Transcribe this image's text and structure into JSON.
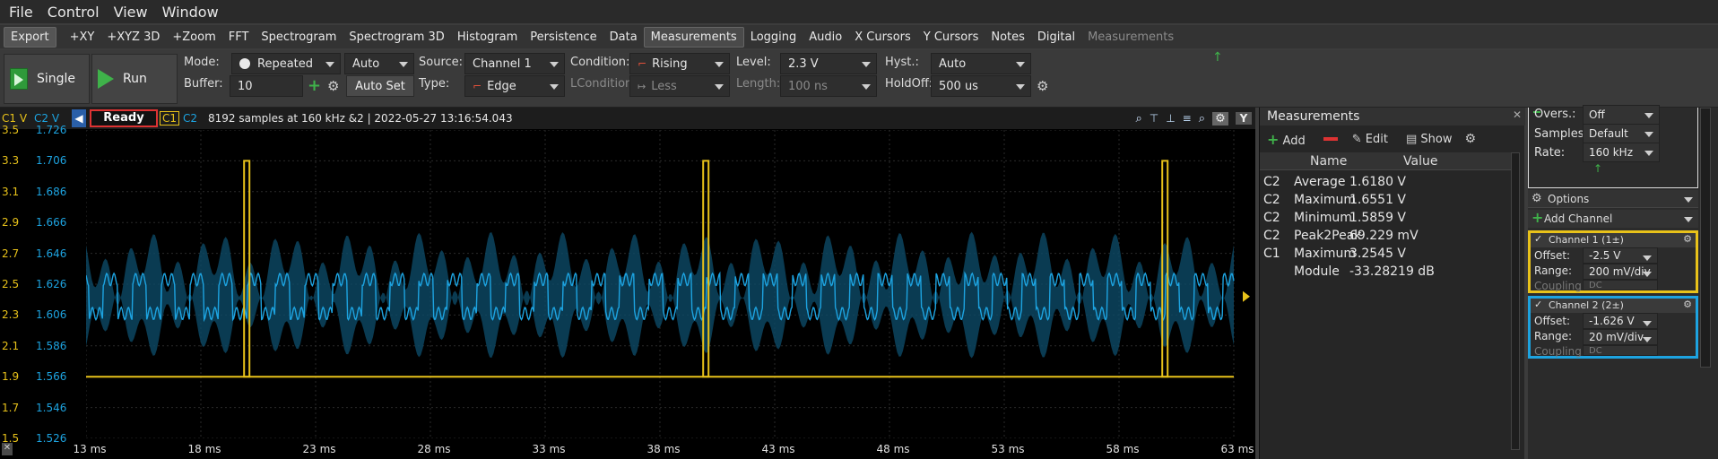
{
  "menu": [
    "File",
    "Control",
    "View",
    "Window"
  ],
  "tabs": {
    "export": "Export",
    "items": [
      "+XY",
      "+XYZ 3D",
      "+Zoom",
      "FFT",
      "Spectrogram",
      "Spectrogram 3D",
      "Histogram",
      "Persistence",
      "Data",
      "Measurements",
      "Logging",
      "Audio",
      "X Cursors",
      "Y Cursors",
      "Notes",
      "Digital"
    ],
    "active": "Measurements",
    "disabled": "Measurements"
  },
  "control": {
    "single": "Single",
    "run": "Run",
    "mode_label": "Mode:",
    "mode_value": "Repeated",
    "mode_auto": "Auto",
    "buffer_label": "Buffer:",
    "buffer_value": "10",
    "autoset": "Auto Set",
    "source_label": "Source:",
    "source_value": "Channel 1",
    "type_label": "Type:",
    "type_value": "Edge",
    "condition_label": "Condition:",
    "condition_value": "Rising",
    "lcondition_label": "LCondition:",
    "lcondition_value": "Less",
    "level_label": "Level:",
    "level_value": "2.3 V",
    "length_label": "Length:",
    "length_value": "100 ns",
    "hyst_label": "Hyst.:",
    "hyst_value": "Auto",
    "holdoff_label": "HoldOff:",
    "holdoff_value": "500 us"
  },
  "plot": {
    "c1_axis": "C1 V",
    "c2_axis": "C2 V",
    "status": "Ready",
    "c1_tag": "C1",
    "c2_tag": "C2",
    "info": "8192 samples at 160 kHz &2 | 2022-05-27 13:16:54.043",
    "y_axis_btn": "Y",
    "c1_ticks": [
      "3.5",
      "3.3",
      "3.1",
      "2.9",
      "2.7",
      "2.5",
      "2.3",
      "2.1",
      "1.9",
      "1.7",
      "1.5"
    ],
    "c2_ticks": [
      "1.726",
      "1.706",
      "1.686",
      "1.666",
      "1.646",
      "1.626",
      "1.606",
      "1.586",
      "1.566",
      "1.546",
      "1.526"
    ],
    "x_ticks": [
      "13 ms",
      "18 ms",
      "23 ms",
      "28 ms",
      "33 ms",
      "38 ms",
      "43 ms",
      "48 ms",
      "53 ms",
      "58 ms",
      "63 ms"
    ]
  },
  "chart_data": {
    "type": "line",
    "x_unit": "ms",
    "xlim": [
      13,
      63
    ],
    "series": [
      {
        "name": "C1",
        "color": "#e8c21a",
        "baseline_v": 1.9,
        "pulses_ms": [
          20.0,
          40.0,
          60.0
        ],
        "pulse_high_v": 3.3
      },
      {
        "name": "C2",
        "color": "#1da3e0",
        "mean_v": 1.618,
        "min_v": 1.5859,
        "max_v": 1.6551
      }
    ],
    "c1_ylim": [
      1.5,
      3.5
    ],
    "c2_ylim": [
      1.526,
      1.726
    ]
  },
  "measurements": {
    "title": "Measurements",
    "add": "Add",
    "edit": "Edit",
    "show": "Show",
    "headers": [
      "Name",
      "Value"
    ],
    "rows": [
      {
        "ch": "C2",
        "name": "Average",
        "value": "1.6180 V"
      },
      {
        "ch": "C2",
        "name": "Maximum",
        "value": "1.6551 V"
      },
      {
        "ch": "C2",
        "name": "Minimum",
        "value": "1.5859 V"
      },
      {
        "ch": "C2",
        "name": "Peak2Peak",
        "value": "69.229 mV"
      },
      {
        "ch": "C1",
        "name": "Maximum",
        "value": "3.2545 V"
      },
      {
        "ch": "",
        "name": "Module",
        "value": "-33.28219 dB"
      }
    ]
  },
  "right_panel": {
    "overs_label": "Overs.:",
    "overs_value": "Off",
    "samples_label": "Samples:",
    "samples_value": "Default",
    "rate_label": "Rate:",
    "rate_value": "160 kHz",
    "options": "Options",
    "add_channel": "Add Channel",
    "ch1": {
      "title": "Channel 1 (1±)",
      "offset_label": "Offset:",
      "offset": "-2.5 V",
      "range_label": "Range:",
      "range": "200 mV/div",
      "coupling_label": "Coupling:",
      "coupling": "DC"
    },
    "ch2": {
      "title": "Channel 2 (2±)",
      "offset_label": "Offset:",
      "offset": "-1.626 V",
      "range_label": "Range:",
      "range": "20 mV/div",
      "coupling_label": "Coupling:",
      "coupling": "DC"
    }
  }
}
